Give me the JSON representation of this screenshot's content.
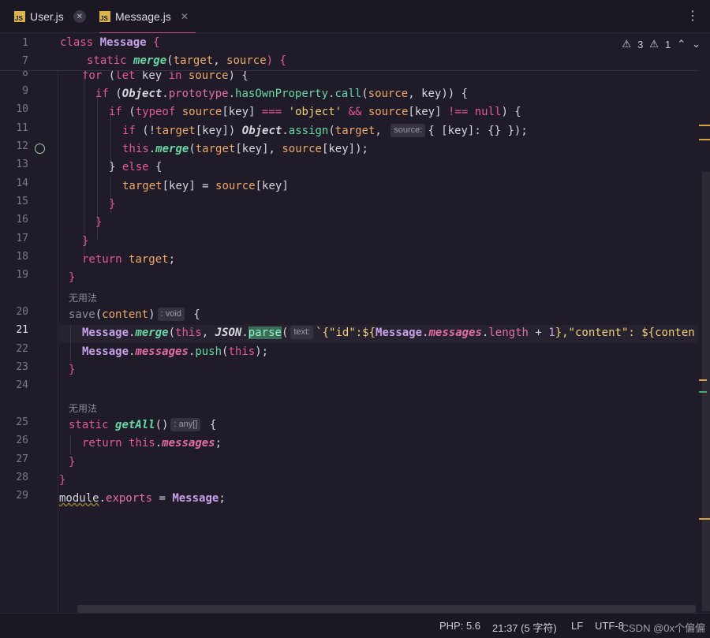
{
  "tabs": [
    {
      "badge": "JS",
      "label": "User.js"
    },
    {
      "badge": "JS",
      "label": "Message.js"
    }
  ],
  "tab_close_glyph": "✕",
  "menu_glyph": "⋮",
  "inspections": {
    "warnings": "3",
    "weak_warnings": "1"
  },
  "hints": {
    "unused_1": "无用法",
    "unused_2": "无用法"
  },
  "inlay": {
    "source_param": "source:",
    "void_type": ": void",
    "text_param": "text:",
    "any_type": ": any[]"
  },
  "line_numbers": {
    "l1": "1",
    "l7": "7",
    "l8": "8",
    "l9": "9",
    "l10": "10",
    "l11": "11",
    "l12": "12",
    "l13": "13",
    "l14": "14",
    "l15": "15",
    "l16": "16",
    "l17": "17",
    "l18": "18",
    "l19": "19",
    "l20": "20",
    "l21": "21",
    "l22": "22",
    "l23": "23",
    "l24": "24",
    "l25": "25",
    "l26": "26",
    "l27": "27",
    "l28": "28",
    "l29": "29"
  },
  "code": {
    "class_kw": "class",
    "class_name": "Message",
    "brace_open": " {",
    "static_kw": "static",
    "merge_fn": "merge",
    "merge_params_a": "(",
    "target": "target",
    "comma_sp": ", ",
    "source": "source",
    "merge_params_b": ") {",
    "for_kw": "for",
    "let_kw": "let",
    "key": "key",
    "in_kw": "in",
    "if_kw": "if",
    "Object": "Object",
    "prototype": "prototype",
    "hasOwn": "hasOwnProperty",
    "call": "call",
    "typeof_kw": "typeof",
    "object_str": "'object'",
    "null_kw": "null",
    "assign": "assign",
    "this_kw": "this",
    "else_kw": "else",
    "return_kw": "return",
    "save_fn": "save",
    "content": "content",
    "JSON": "JSON",
    "parse": "parse",
    "template_a": "`{\"id\":${",
    "messages": "messages",
    "length": "length",
    "one": "1",
    "template_b": "},\"content\": ${conten",
    "push": "push",
    "getAll": "getAll",
    "module": "module",
    "exports": "exports"
  },
  "status": {
    "php": "PHP: 5.6",
    "position": "21:37 (5 字符)",
    "line_sep": "LF",
    "encoding": "UTF-8",
    "watermark": "CSDN @0x个偏偏"
  },
  "colors": {
    "accent": "#c64f8c",
    "keyword": "#e35a9b",
    "function": "#67d7a5",
    "string": "#f3d07a"
  }
}
